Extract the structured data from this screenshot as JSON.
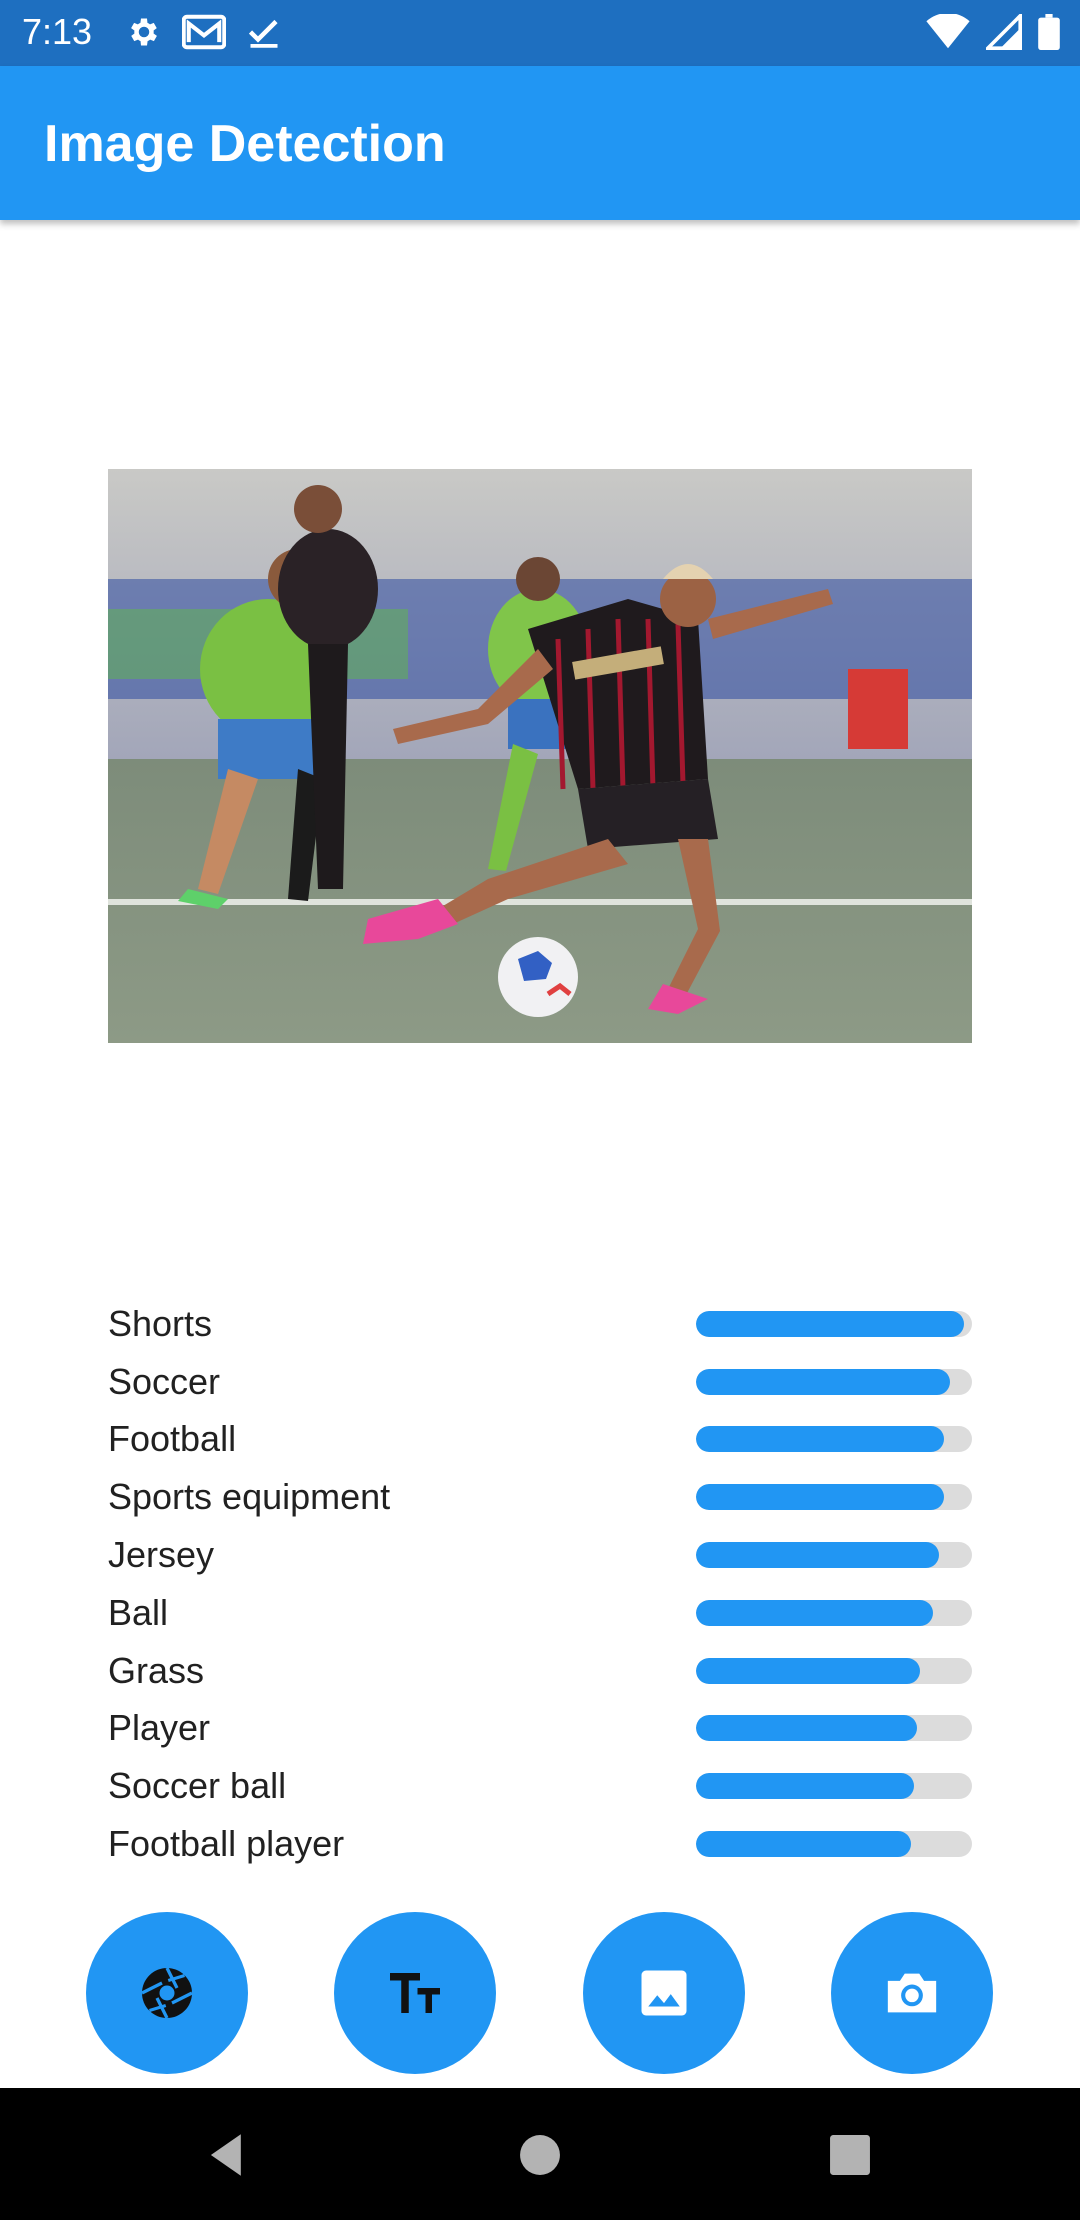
{
  "status_bar": {
    "time": "7:13",
    "left_icons": [
      "gear-icon",
      "gmail-icon",
      "check-icon"
    ],
    "right_icons": [
      "wifi-icon",
      "signal-icon",
      "battery-icon"
    ]
  },
  "app_bar": {
    "title": "Image Detection",
    "color": "#2196f3"
  },
  "photo": {
    "subject": "soccer player kicking ball"
  },
  "labels": [
    {
      "name": "Shorts",
      "confidence": 0.97
    },
    {
      "name": "Soccer",
      "confidence": 0.92
    },
    {
      "name": "Football",
      "confidence": 0.9
    },
    {
      "name": "Sports equipment",
      "confidence": 0.9
    },
    {
      "name": "Jersey",
      "confidence": 0.88
    },
    {
      "name": "Ball",
      "confidence": 0.86
    },
    {
      "name": "Grass",
      "confidence": 0.81
    },
    {
      "name": "Player",
      "confidence": 0.8
    },
    {
      "name": "Soccer ball",
      "confidence": 0.79
    },
    {
      "name": "Football player",
      "confidence": 0.78
    }
  ],
  "actions": [
    {
      "name": "aperture-icon"
    },
    {
      "name": "text-recognition-icon"
    },
    {
      "name": "gallery-icon"
    },
    {
      "name": "camera-icon"
    }
  ],
  "nav_bar": {
    "buttons": [
      "back-icon",
      "home-icon",
      "recents-icon"
    ]
  }
}
